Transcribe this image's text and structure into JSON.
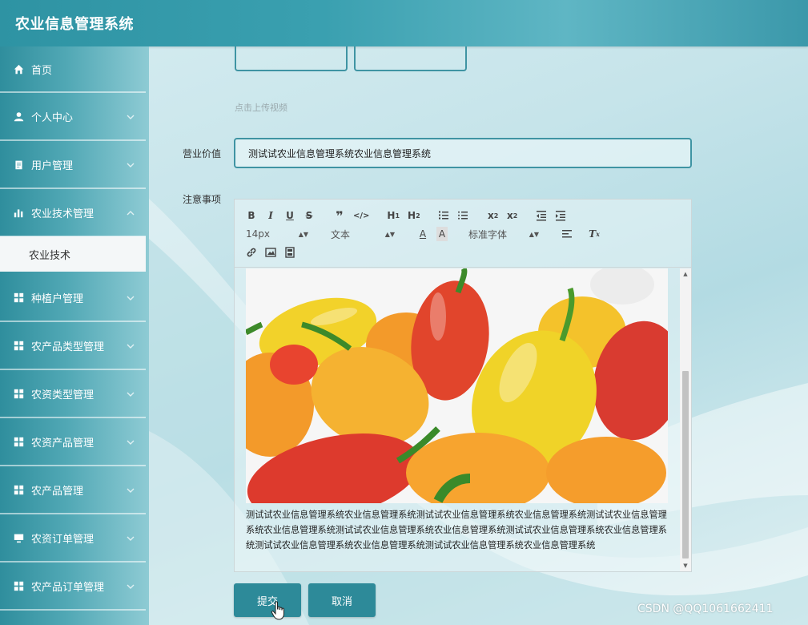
{
  "app": {
    "title": "农业信息管理系统"
  },
  "sidebar": {
    "items": [
      {
        "label": "首页",
        "icon": "home-icon"
      },
      {
        "label": "个人中心",
        "icon": "user-icon"
      },
      {
        "label": "用户管理",
        "icon": "clipboard-icon"
      },
      {
        "label": "农业技术管理",
        "icon": "bar-chart-icon"
      },
      {
        "label": "种植户管理",
        "icon": "grid-icon"
      },
      {
        "label": "农产品类型管理",
        "icon": "grid-icon"
      },
      {
        "label": "农资类型管理",
        "icon": "grid-icon"
      },
      {
        "label": "农资产品管理",
        "icon": "grid-icon"
      },
      {
        "label": "农产品管理",
        "icon": "grid-icon"
      },
      {
        "label": "农资订单管理",
        "icon": "monitor-icon"
      },
      {
        "label": "农产品订单管理",
        "icon": "grid-icon"
      }
    ],
    "submenu": {
      "label": "农业技术"
    }
  },
  "form": {
    "upload_hint": "点击上传视频",
    "business_value_label": "营业价值",
    "business_value": "测试试农业信息管理系统农业信息管理系统",
    "notes_label": "注意事项"
  },
  "editor": {
    "font_size": "14px",
    "text_style": "文本",
    "font_family": "标准字体",
    "content": "测试试农业信息管理系统农业信息管理系统测试试农业信息管理系统农业信息管理系统测试试农业信息管理系统农业信息管理系统测试试农业信息管理系统农业信息管理系统测试试农业信息管理系统农业信息管理系统测试试农业信息管理系统农业信息管理系统测试试农业信息管理系统农业信息管理系统"
  },
  "buttons": {
    "submit": "提交",
    "cancel": "取消"
  },
  "watermark": "CSDN @QQ1061662411",
  "colors": {
    "accent": "#2d8a99",
    "topbar": "#3aa0b0"
  }
}
